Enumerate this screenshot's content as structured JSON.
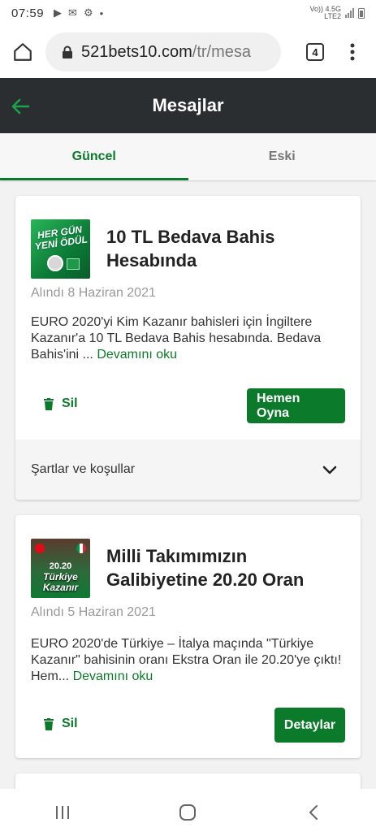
{
  "status": {
    "time": "07:59",
    "network": "Vo)) 4.5G",
    "network2": "LTE2"
  },
  "browser": {
    "url_host": "521bets10.com",
    "url_path": "/tr/mesa",
    "tab_count": "4"
  },
  "header": {
    "title": "Mesajlar"
  },
  "tabs": [
    {
      "label": "Güncel",
      "active": true
    },
    {
      "label": "Eski",
      "active": false
    }
  ],
  "messages": [
    {
      "thumb_text": [
        "HER GÜN",
        "YENİ ÖDÜL"
      ],
      "title": "10 TL Bedava Bahis Hesabında",
      "date": "Alındı 8 Haziran 2021",
      "body": "EURO 2020'yi Kim Kazanır bahisleri için İngiltere Kazanır'a 10 TL Bedava Bahis hesabında. Bedava Bahis'ini ...",
      "more": "Devamını oku",
      "delete_label": "Sil",
      "action_label": "Hemen Oyna",
      "terms_label": "Şartlar ve koşullar"
    },
    {
      "thumb_text": [
        "20.20",
        "Türkiye",
        "Kazanır"
      ],
      "title": "Milli Takımımızın Galibiyetine 20.20 Oran",
      "date": "Alındı 5 Haziran 2021",
      "body": "EURO 2020'de Türkiye – İtalya maçında \"Türkiye Kazanır\" bahisinin oranı Ekstra Oran ile 20.20'ye çıktı! Hem...",
      "more": "Devamını oku",
      "delete_label": "Sil",
      "action_label": "Detaylar"
    }
  ],
  "colors": {
    "accent": "#0b7a2a",
    "header_bg": "#2b2e31",
    "page_bg": "#f2f2f2"
  },
  "icons": [
    "home-icon",
    "lock-icon",
    "tabs-icon",
    "more-vert-icon",
    "back-arrow-icon",
    "trash-icon",
    "chevron-down-icon",
    "recent-apps-icon",
    "home-circle-icon",
    "back-chevron-icon"
  ]
}
